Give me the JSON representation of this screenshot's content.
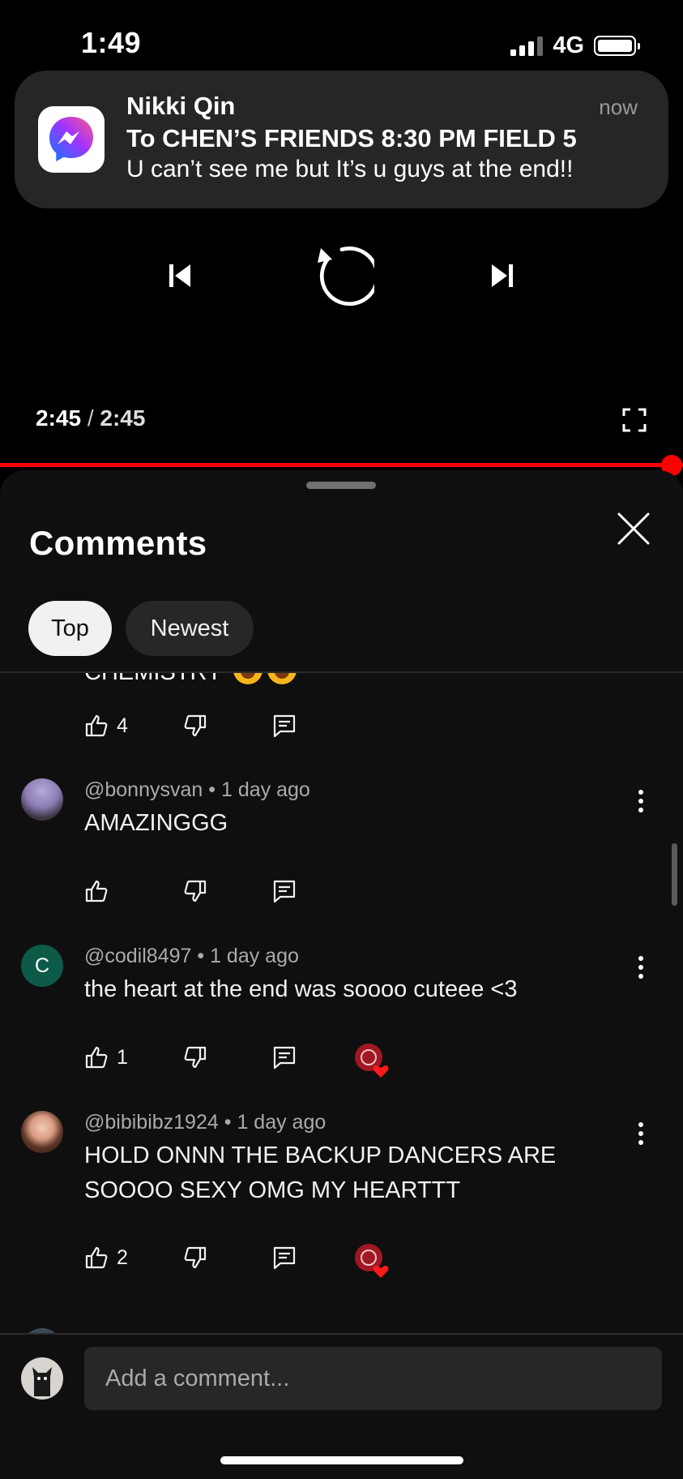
{
  "status_bar": {
    "time": "1:49",
    "network": "4G"
  },
  "notification": {
    "app_icon": "messenger-icon",
    "sender": "Nikki Qin",
    "time": "now",
    "title": "To CHEN’S FRIENDS 8:30 PM FIELD 5",
    "body": "U can’t see me but It’s u guys at the end!!"
  },
  "player": {
    "current_time": "2:45",
    "separator": "/",
    "duration": "2:45",
    "progress_fraction": 1.0,
    "accent_color": "#ff0000"
  },
  "comments_panel": {
    "title": "Comments",
    "filters": [
      {
        "label": "Top",
        "selected": true
      },
      {
        "label": "Newest",
        "selected": false
      }
    ],
    "partial_comment": {
      "text": "CHEMISTRY",
      "likes": "4"
    },
    "comments": [
      {
        "handle": "@bonnysvan",
        "age": "1 day ago",
        "text": "AMAZINGGG",
        "likes": "",
        "creator_heart": false
      },
      {
        "handle": "@codil8497",
        "age": "1 day ago",
        "avatar_letter": "C",
        "text": "the heart at the end was soooo cuteee <3",
        "likes": "1",
        "creator_heart": true
      },
      {
        "handle": "@bibibibz1924",
        "age": "1 day ago",
        "text": "HOLD ONNN THE BACKUP DANCERS ARE SOOOO SEXY OMG MY HEARTTT",
        "likes": "2",
        "creator_heart": true
      }
    ],
    "input_placeholder": "Add a comment..."
  }
}
